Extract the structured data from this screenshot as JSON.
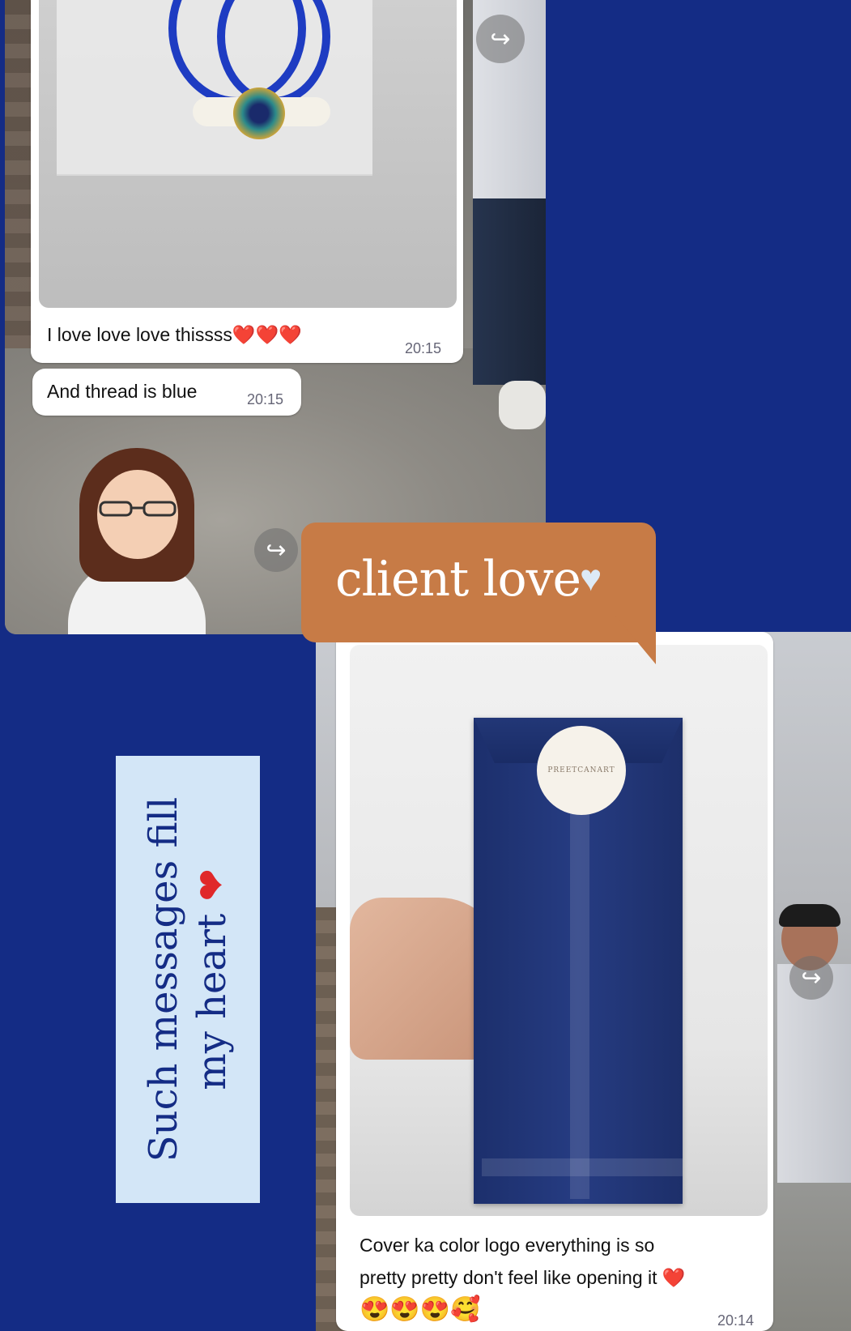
{
  "top_chat": {
    "message_1": "I love love love thissss",
    "message_1_hearts": "❤️❤️❤️",
    "message_1_time": "20:15",
    "message_2": "And thread is blue",
    "message_2_time": "20:15",
    "forward_icon": "↪"
  },
  "banner": {
    "text": "client love",
    "heart": "♥"
  },
  "side_label": {
    "line_1": "Such messages fill",
    "line_2": "my heart",
    "heart": "❤"
  },
  "bottom_chat": {
    "message_line_1": "Cover ka color logo everything is so",
    "message_line_2": "pretty pretty don't feel like opening it",
    "message_heart": "❤️",
    "emojis": "😍😍😍🥰",
    "time": "20:14",
    "forward_icon": "↪",
    "logo_text": "PREETCANART"
  },
  "colors": {
    "background": "#142c85",
    "banner": "#c77b46",
    "side_label_bg": "#d3e6f7",
    "bubble": "#ffffff"
  }
}
